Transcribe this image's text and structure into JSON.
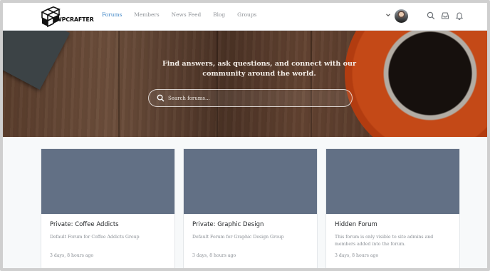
{
  "header": {
    "logo_text": "WPCRAFTER",
    "nav": [
      {
        "label": "Forums",
        "active": true
      },
      {
        "label": "Members",
        "active": false
      },
      {
        "label": "News Feed",
        "active": false
      },
      {
        "label": "Blog",
        "active": false
      },
      {
        "label": "Groups",
        "active": false
      }
    ],
    "icons": [
      "chevron-down-icon",
      "avatar",
      "search-icon",
      "inbox-icon",
      "bell-icon"
    ],
    "accent_color": "#3a83c5"
  },
  "hero": {
    "title": "Find answers, ask questions, and connect with our community around the world.",
    "search_placeholder": "Search forums..."
  },
  "forums": [
    {
      "title": "Private: Coffee Addicts",
      "description": "Default Forum for Coffee Addicts Group",
      "time": "3 days, 8 hours ago"
    },
    {
      "title": "Private: Graphic Design",
      "description": "Default Forum for Graphic Design Group",
      "time": "3 days, 8 hours ago"
    },
    {
      "title": "Hidden Forum",
      "description": "This forum is only visible to site admins and members added into the forum.",
      "time": "3 days, 8 hours ago"
    }
  ],
  "colors": {
    "thumb": "#627085",
    "text_muted": "#8a8f95"
  }
}
